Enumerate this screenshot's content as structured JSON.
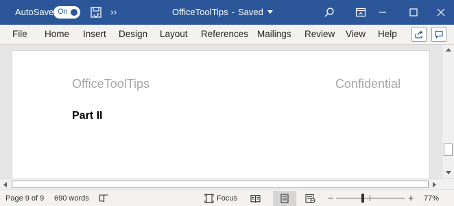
{
  "titlebar": {
    "autosave_label": "AutoSave",
    "autosave_state": "On",
    "more_label": "››",
    "doc_name": "OfficeToolTips",
    "separator": "-",
    "save_status": "Saved"
  },
  "ribbon": {
    "tabs": [
      "File",
      "Home",
      "Insert",
      "Design",
      "Layout",
      "References",
      "Mailings",
      "Review",
      "View",
      "Help"
    ]
  },
  "document": {
    "header_left": "OfficeToolTips",
    "header_right": "Confidential",
    "heading": "Part II"
  },
  "statusbar": {
    "page_info": "Page 9 of 9",
    "word_count": "690 words",
    "focus_label": "Focus",
    "zoom_minus": "−",
    "zoom_plus": "+",
    "zoom_level": "77%",
    "zoom_percent": 77
  },
  "colors": {
    "titlebar_bg": "#2b579a",
    "ribbon_bg": "#f3f2f1",
    "page_bg": "#ffffff",
    "doc_area_bg": "#e6e6e6",
    "header_text": "#a6a6a6"
  }
}
